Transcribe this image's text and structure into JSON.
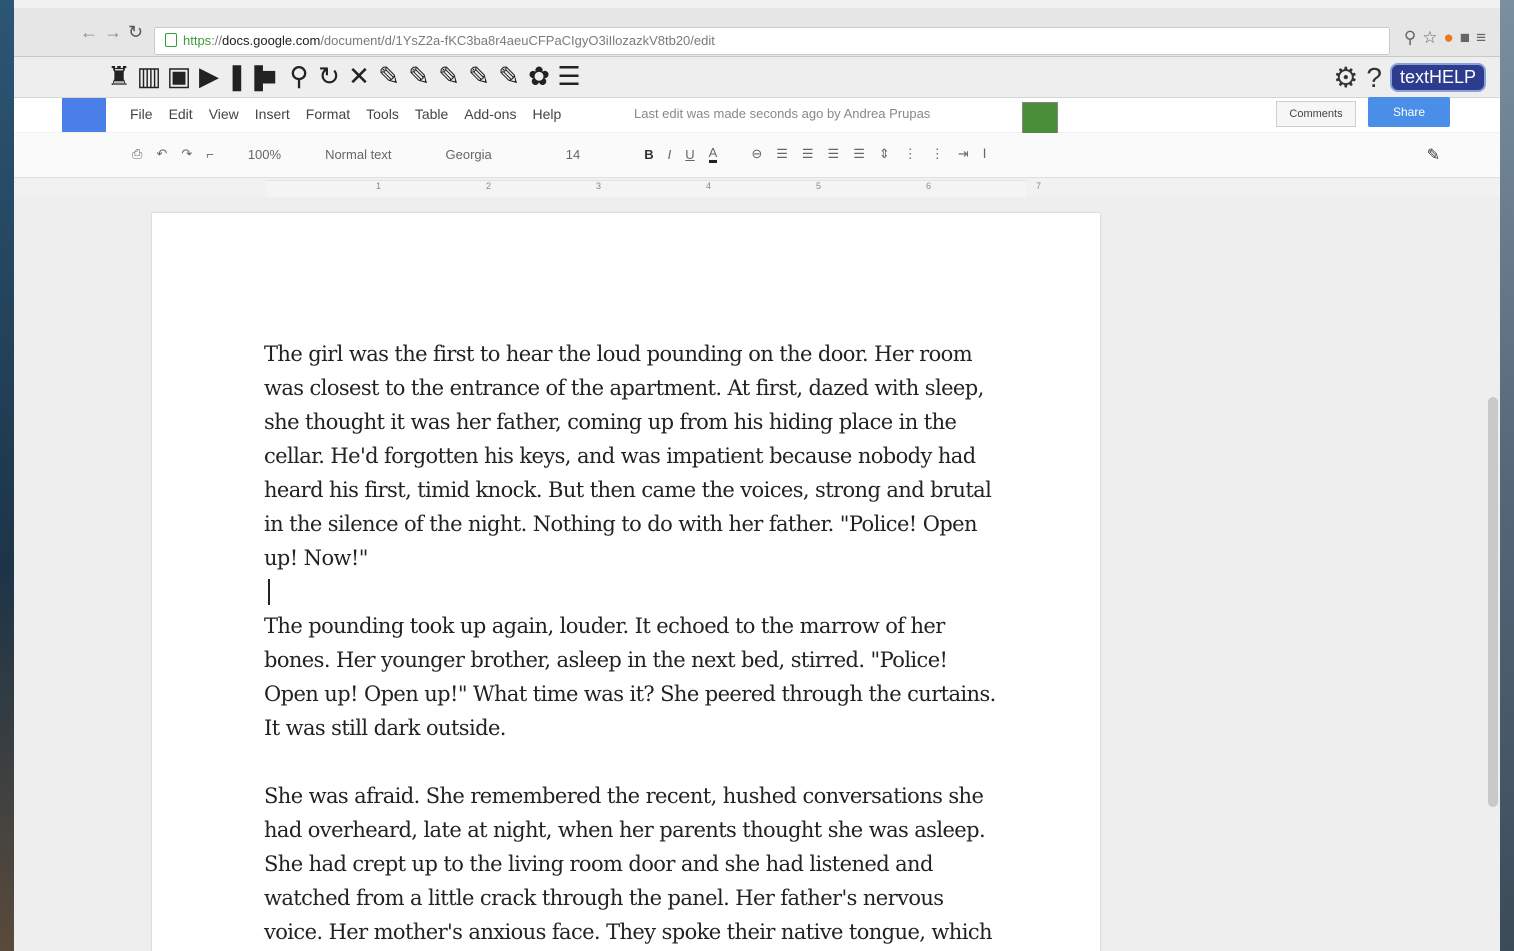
{
  "browser": {
    "url_scheme": "https",
    "url_host": "docs.google.com",
    "url_path": "/document/d/1YsZ2a-fKC3ba8r4aeuCFPaCIgyO3iIlozazkV8tb20/edit",
    "icons": [
      "back-icon",
      "forward-icon",
      "reload-icon",
      "lock-icon",
      "star-icon",
      "extension-icon",
      "menu-icon"
    ]
  },
  "texthelp": {
    "logo": "textHELP",
    "tools": [
      "♜",
      "▥",
      "▣",
      "▶",
      "❚❚",
      "■",
      "⚲",
      "↻",
      "✕",
      "✎",
      "✎",
      "✎",
      "✎",
      "✎",
      "✿",
      "☰"
    ]
  },
  "docs": {
    "menu": [
      "File",
      "Edit",
      "View",
      "Insert",
      "Format",
      "Tools",
      "Table",
      "Add-ons",
      "Help"
    ],
    "last_edit": "Last edit was made seconds ago by Andrea Prupas",
    "comments": "Comments",
    "share": "Share"
  },
  "format": {
    "zoom": "100%",
    "style": "Normal text",
    "font": "Georgia",
    "size": "14",
    "bold": "B",
    "italic": "I",
    "underline": "U",
    "text_color": "A"
  },
  "ruler": [
    "1",
    "2",
    "3",
    "4",
    "5",
    "6",
    "7"
  ],
  "document": {
    "paragraphs": [
      "The girl was the first to hear the loud pounding on the door. Her room was closest to the entrance of the apartment. At first, dazed with sleep, she thought it was her father, coming up from his hiding place in the cellar. He'd forgotten his keys, and was impatient because nobody had heard his first, timid knock. But then came the voices, strong and brutal in the silence of the night. Nothing to do with her father. \"Police! Open up! Now!\"",
      "The pounding took up again, louder. It echoed to the marrow of her bones. Her younger brother, asleep in the next bed, stirred. \"Police! Open up! Open up!\" What time was it? She peered through the curtains. It was still dark outside.",
      "She was afraid. She remembered the recent, hushed conversations she had overheard, late at night, when her parents thought she was asleep. She had crept up to the living room door and she had listened and watched from a little crack through the panel. Her father's nervous voice. Her mother's anxious face. They spoke their native tongue, which the girl"
    ]
  }
}
